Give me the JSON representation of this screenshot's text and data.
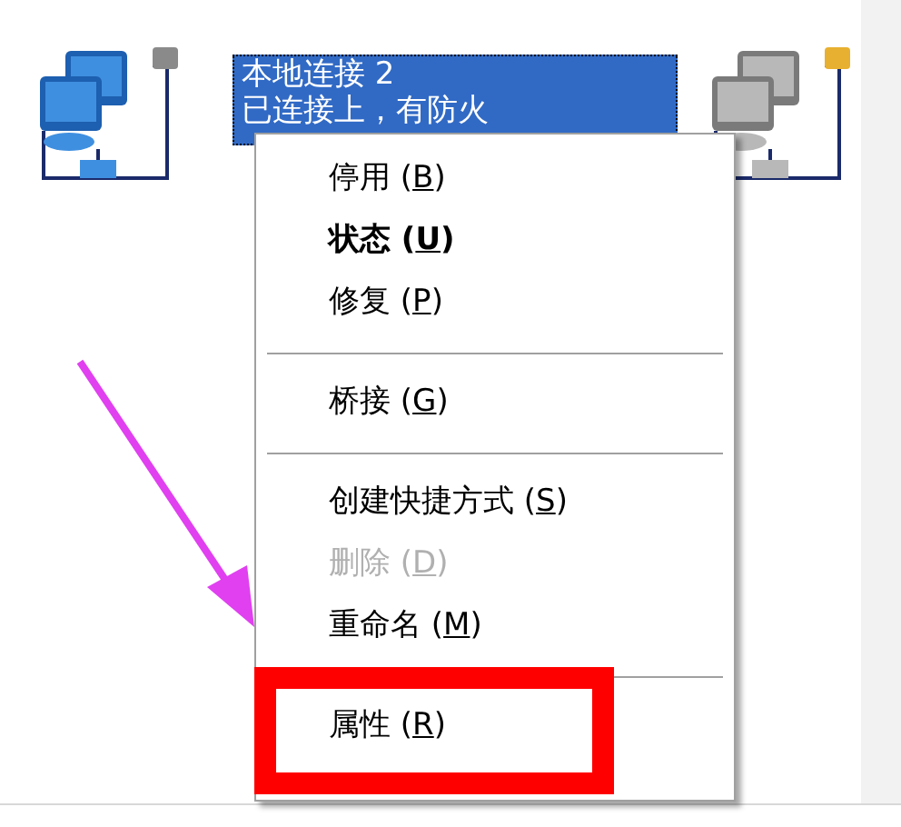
{
  "connections": [
    {
      "kind": "active",
      "lines": [
        "本地连接 2",
        "已连接上，有防火"
      ],
      "selected": true
    },
    {
      "kind": "inactive"
    }
  ],
  "context_menu": {
    "items": [
      {
        "kind": "item",
        "label": "停用",
        "key": "(B)",
        "default": false,
        "disabled": false,
        "highlighted": false
      },
      {
        "kind": "item",
        "label": "状态",
        "key": "(U)",
        "default": true,
        "disabled": false,
        "highlighted": false
      },
      {
        "kind": "item",
        "label": "修复",
        "key": "(P)",
        "default": false,
        "disabled": false,
        "highlighted": false
      },
      {
        "kind": "separator"
      },
      {
        "kind": "item",
        "label": "桥接",
        "key": "(G)",
        "default": false,
        "disabled": false,
        "highlighted": false
      },
      {
        "kind": "separator"
      },
      {
        "kind": "item",
        "label": "创建快捷方式",
        "key": "(S)",
        "default": false,
        "disabled": false,
        "highlighted": false
      },
      {
        "kind": "item",
        "label": "删除",
        "key": "(D)",
        "default": false,
        "disabled": true,
        "highlighted": false
      },
      {
        "kind": "item",
        "label": "重命名",
        "key": "(M)",
        "default": false,
        "disabled": false,
        "highlighted": false
      },
      {
        "kind": "separator"
      },
      {
        "kind": "item",
        "label": "属性",
        "key": "(R)",
        "default": false,
        "disabled": false,
        "highlighted": true
      }
    ]
  }
}
